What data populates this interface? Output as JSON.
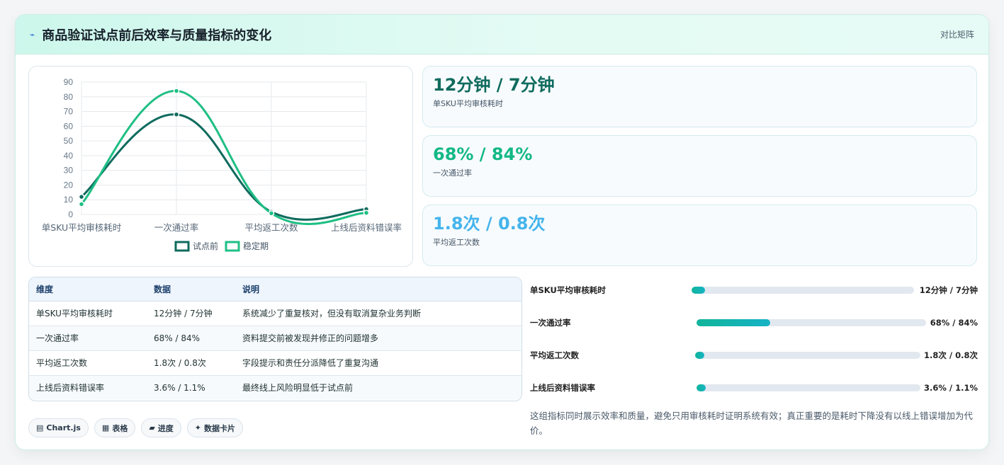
{
  "header": {
    "title": "商品验证试点前后效率与质量指标的变化",
    "title_icon": "line-chart-icon",
    "link": "对比矩阵"
  },
  "stats": [
    {
      "value": "12分钟 / 7分钟",
      "label": "单SKU平均审核耗时",
      "color": "#0f6b5e"
    },
    {
      "value": "68% / 84%",
      "label": "一次通过率",
      "color": "#12b886"
    },
    {
      "value": "1.8次 / 0.8次",
      "label": "平均返工次数",
      "color": "#45b4ec"
    }
  ],
  "table": {
    "headers": [
      "维度",
      "数据",
      "说明"
    ],
    "rows": [
      [
        "单SKU平均审核耗时",
        "12分钟 / 7分钟",
        "系统减少了重复核对，但没有取消复杂业务判断"
      ],
      [
        "一次通过率",
        "68% / 84%",
        "资料提交前被发现并修正的问题增多"
      ],
      [
        "平均返工次数",
        "1.8次 / 0.8次",
        "字段提示和责任分派降低了重复沟通"
      ],
      [
        "上线后资料错误率",
        "3.6% / 1.1%",
        "最终线上风险明显低于试点前"
      ]
    ]
  },
  "progress": [
    {
      "label": "单SKU平均审核耗时",
      "value": "12分钟 / 7分钟",
      "fill": 0.06
    },
    {
      "label": "一次通过率",
      "value": "68% / 84%",
      "fill": 0.32
    },
    {
      "label": "平均返工次数",
      "value": "1.8次 / 0.8次",
      "fill": 0.04
    },
    {
      "label": "上线后资料错误率",
      "value": "3.6% / 1.1%",
      "fill": 0.04
    }
  ],
  "note": "这组指标同时展示效率和质量，避免只用审核耗时证明系统有效；真正重要的是耗时下降没有以线上错误增加为代价。",
  "tags": [
    {
      "icon": "chart-icon",
      "glyph": "▤",
      "label": "Chart.js"
    },
    {
      "icon": "table-icon",
      "glyph": "▦",
      "label": "表格"
    },
    {
      "icon": "progress-icon",
      "glyph": "▰",
      "label": "进度"
    },
    {
      "icon": "sparkle-icon",
      "glyph": "✦",
      "label": "数据卡片"
    }
  ],
  "chart_data": {
    "type": "line",
    "categories": [
      "单SKU平均审核耗时",
      "一次通过率",
      "平均返工次数",
      "上线后资料错误率"
    ],
    "series": [
      {
        "name": "试点前",
        "values": [
          12,
          68,
          1.8,
          3.6
        ],
        "color": "#0f6b5e"
      },
      {
        "name": "稳定期",
        "values": [
          7,
          84,
          0.8,
          1.1
        ],
        "color": "#1fbf84"
      }
    ],
    "yticks": [
      0,
      10,
      20,
      30,
      40,
      50,
      60,
      70,
      80,
      90
    ],
    "ylim": [
      0,
      90
    ],
    "grid": true,
    "legend": "bottom"
  }
}
